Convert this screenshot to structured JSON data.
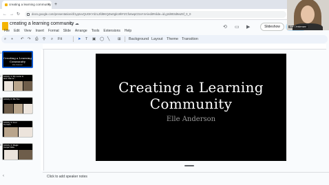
{
  "browser": {
    "tab_title": "creating a learning community",
    "tab_close": "×",
    "new_tab": "+",
    "back": "←",
    "forward": "→",
    "reload": "↻",
    "url": "docs.google.com/presentation/d/1ypIxvQUGKYdzL2fd8KQZw0gk19hFZCfo6wpCDaY4A/edit#slide=id.g2d803d9a25f_0_0"
  },
  "doc": {
    "title": "creating a learning community",
    "menu": [
      "File",
      "Edit",
      "View",
      "Insert",
      "Format",
      "Slide",
      "Arrange",
      "Tools",
      "Extensions",
      "Help"
    ],
    "slideshow_label": "Slideshow",
    "share_label": ""
  },
  "toolbar": {
    "zoom": "Fit",
    "background": "Background",
    "layout": "Layout",
    "theme": "Theme",
    "transition": "Transition"
  },
  "slides_panel": {
    "thumbnails": [
      {
        "num": "1",
        "title": "Creating a Learning Community",
        "subtitle": "Elle Anderson"
      },
      {
        "num": "2",
        "label": "Activity 1: My name is and I like to..."
      },
      {
        "num": "3",
        "label": "Activity 2: Me Too"
      },
      {
        "num": "4",
        "label": "Activity 3: Four Corners"
      },
      {
        "num": "5",
        "label": "Activity 4: Magic Carpet Ride"
      }
    ]
  },
  "slide": {
    "title": "Creating a Learning Community",
    "subtitle": "Elle Anderson"
  },
  "notes": {
    "placeholder": "Click to add speaker notes"
  },
  "webcam": {
    "name": "Elle Christensen"
  },
  "icons": {
    "star": "☆",
    "move": "⧉",
    "cloud": "☁",
    "history": "⟲",
    "comment": "▭",
    "camera": "▶",
    "search": "⌕",
    "add": "+",
    "undo": "↶",
    "redo": "↷",
    "print": "⎙",
    "paint": "⚲",
    "select": "➤",
    "textbox": "T",
    "image": "▣",
    "shape": "◯",
    "line": "╲",
    "comment_add": "⊞",
    "collapse": "‹"
  },
  "colors": {
    "accent": "#0b57d0",
    "share_bg": "#c2e7ff",
    "slide_bg": "#000000"
  }
}
